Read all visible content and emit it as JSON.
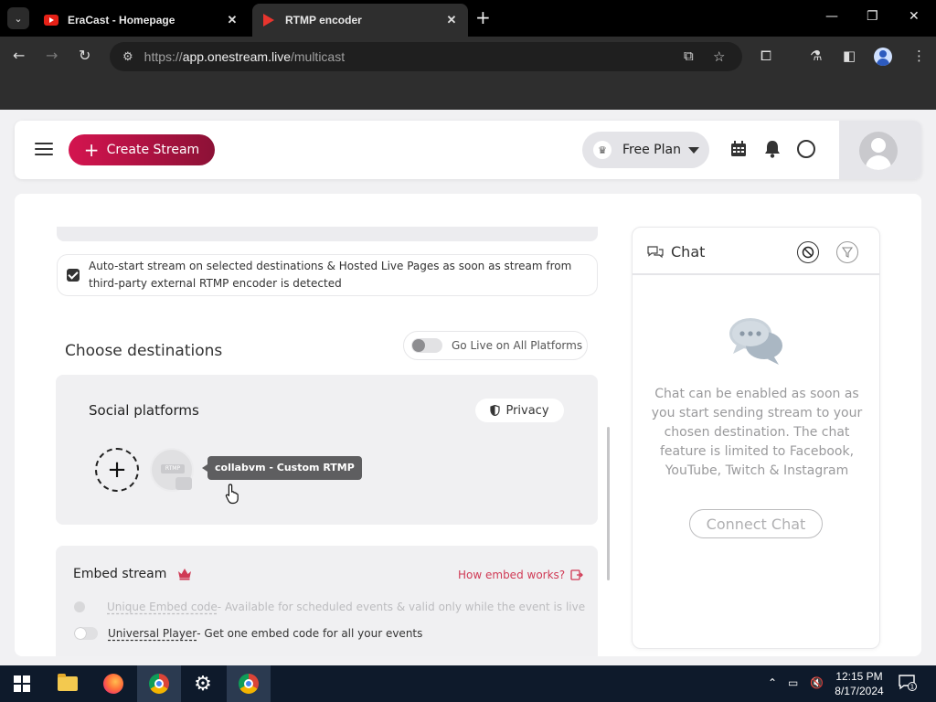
{
  "browser": {
    "tabs": [
      {
        "title": "EraCast - Homepage",
        "active": false,
        "favicon": "youtube-favicon"
      },
      {
        "title": "RTMP encoder",
        "active": true,
        "favicon": "rtmp-favicon"
      }
    ],
    "url": {
      "scheme": "https://",
      "host": "app.onestream.live",
      "path": "/multicast"
    }
  },
  "header": {
    "create_stream_label": "Create Stream",
    "plan_label": "Free Plan"
  },
  "settings": {
    "autostart_checked": true,
    "autostart_text": "Auto-start stream on selected destinations & Hosted Live Pages as soon as stream from third-party external RTMP encoder is detected"
  },
  "destinations": {
    "title": "Choose destinations",
    "go_live_all_label": "Go Live on All Platforms",
    "go_live_all_on": false,
    "social_title": "Social platforms",
    "privacy_label": "Privacy",
    "tooltip": "collabvm - Custom RTMP",
    "rtmp_badge": "RTMP"
  },
  "embed": {
    "title": "Embed stream",
    "how_label": "How embed works?",
    "options": [
      {
        "name": "Unique Embed code",
        "desc": " - Available for scheduled events & valid only while the event is live",
        "enabled": false
      },
      {
        "name": "Universal Player",
        "desc": " - Get one embed code for all your events",
        "enabled": false
      }
    ]
  },
  "chat": {
    "title": "Chat",
    "message": "Chat can be enabled as soon as you start sending stream to your chosen destination. The chat feature is limited to Facebook, YouTube, Twitch & Instagram",
    "connect_label": "Connect Chat"
  },
  "taskbar": {
    "time": "12:15 PM",
    "date": "8/17/2024",
    "notification_count": "1"
  },
  "colors": {
    "brand_gradient_start": "#d4144f",
    "brand_gradient_end": "#8c1136",
    "link_red": "#d03a55"
  }
}
